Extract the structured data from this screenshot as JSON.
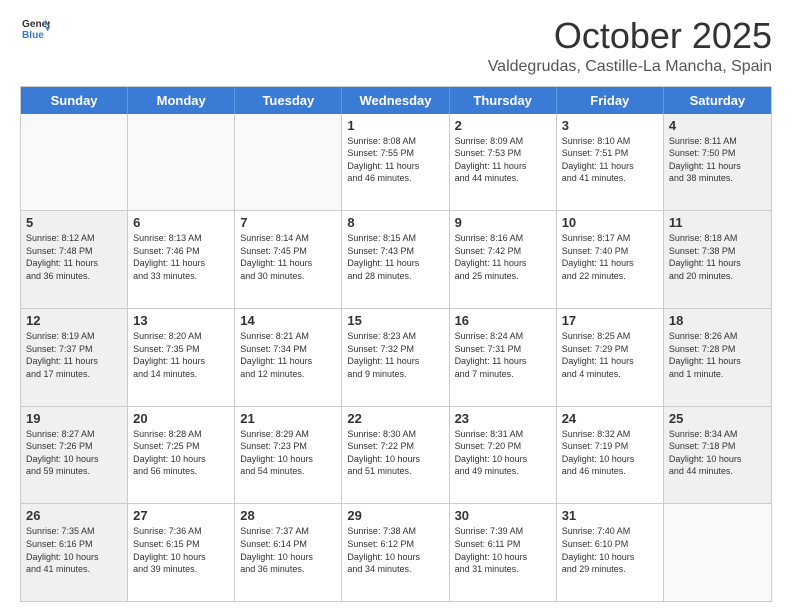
{
  "header": {
    "logo_general": "General",
    "logo_blue": "Blue",
    "month": "October 2025",
    "location": "Valdegrudas, Castille-La Mancha, Spain"
  },
  "weekdays": [
    "Sunday",
    "Monday",
    "Tuesday",
    "Wednesday",
    "Thursday",
    "Friday",
    "Saturday"
  ],
  "rows": [
    [
      {
        "day": "",
        "text": "",
        "empty": true
      },
      {
        "day": "",
        "text": "",
        "empty": true
      },
      {
        "day": "",
        "text": "",
        "empty": true
      },
      {
        "day": "1",
        "text": "Sunrise: 8:08 AM\nSunset: 7:55 PM\nDaylight: 11 hours\nand 46 minutes.",
        "empty": false
      },
      {
        "day": "2",
        "text": "Sunrise: 8:09 AM\nSunset: 7:53 PM\nDaylight: 11 hours\nand 44 minutes.",
        "empty": false
      },
      {
        "day": "3",
        "text": "Sunrise: 8:10 AM\nSunset: 7:51 PM\nDaylight: 11 hours\nand 41 minutes.",
        "empty": false
      },
      {
        "day": "4",
        "text": "Sunrise: 8:11 AM\nSunset: 7:50 PM\nDaylight: 11 hours\nand 38 minutes.",
        "empty": false,
        "shaded": true
      }
    ],
    [
      {
        "day": "5",
        "text": "Sunrise: 8:12 AM\nSunset: 7:48 PM\nDaylight: 11 hours\nand 36 minutes.",
        "empty": false,
        "shaded": true
      },
      {
        "day": "6",
        "text": "Sunrise: 8:13 AM\nSunset: 7:46 PM\nDaylight: 11 hours\nand 33 minutes.",
        "empty": false
      },
      {
        "day": "7",
        "text": "Sunrise: 8:14 AM\nSunset: 7:45 PM\nDaylight: 11 hours\nand 30 minutes.",
        "empty": false
      },
      {
        "day": "8",
        "text": "Sunrise: 8:15 AM\nSunset: 7:43 PM\nDaylight: 11 hours\nand 28 minutes.",
        "empty": false
      },
      {
        "day": "9",
        "text": "Sunrise: 8:16 AM\nSunset: 7:42 PM\nDaylight: 11 hours\nand 25 minutes.",
        "empty": false
      },
      {
        "day": "10",
        "text": "Sunrise: 8:17 AM\nSunset: 7:40 PM\nDaylight: 11 hours\nand 22 minutes.",
        "empty": false
      },
      {
        "day": "11",
        "text": "Sunrise: 8:18 AM\nSunset: 7:38 PM\nDaylight: 11 hours\nand 20 minutes.",
        "empty": false,
        "shaded": true
      }
    ],
    [
      {
        "day": "12",
        "text": "Sunrise: 8:19 AM\nSunset: 7:37 PM\nDaylight: 11 hours\nand 17 minutes.",
        "empty": false,
        "shaded": true
      },
      {
        "day": "13",
        "text": "Sunrise: 8:20 AM\nSunset: 7:35 PM\nDaylight: 11 hours\nand 14 minutes.",
        "empty": false
      },
      {
        "day": "14",
        "text": "Sunrise: 8:21 AM\nSunset: 7:34 PM\nDaylight: 11 hours\nand 12 minutes.",
        "empty": false
      },
      {
        "day": "15",
        "text": "Sunrise: 8:23 AM\nSunset: 7:32 PM\nDaylight: 11 hours\nand 9 minutes.",
        "empty": false
      },
      {
        "day": "16",
        "text": "Sunrise: 8:24 AM\nSunset: 7:31 PM\nDaylight: 11 hours\nand 7 minutes.",
        "empty": false
      },
      {
        "day": "17",
        "text": "Sunrise: 8:25 AM\nSunset: 7:29 PM\nDaylight: 11 hours\nand 4 minutes.",
        "empty": false
      },
      {
        "day": "18",
        "text": "Sunrise: 8:26 AM\nSunset: 7:28 PM\nDaylight: 11 hours\nand 1 minute.",
        "empty": false,
        "shaded": true
      }
    ],
    [
      {
        "day": "19",
        "text": "Sunrise: 8:27 AM\nSunset: 7:26 PM\nDaylight: 10 hours\nand 59 minutes.",
        "empty": false,
        "shaded": true
      },
      {
        "day": "20",
        "text": "Sunrise: 8:28 AM\nSunset: 7:25 PM\nDaylight: 10 hours\nand 56 minutes.",
        "empty": false
      },
      {
        "day": "21",
        "text": "Sunrise: 8:29 AM\nSunset: 7:23 PM\nDaylight: 10 hours\nand 54 minutes.",
        "empty": false
      },
      {
        "day": "22",
        "text": "Sunrise: 8:30 AM\nSunset: 7:22 PM\nDaylight: 10 hours\nand 51 minutes.",
        "empty": false
      },
      {
        "day": "23",
        "text": "Sunrise: 8:31 AM\nSunset: 7:20 PM\nDaylight: 10 hours\nand 49 minutes.",
        "empty": false
      },
      {
        "day": "24",
        "text": "Sunrise: 8:32 AM\nSunset: 7:19 PM\nDaylight: 10 hours\nand 46 minutes.",
        "empty": false
      },
      {
        "day": "25",
        "text": "Sunrise: 8:34 AM\nSunset: 7:18 PM\nDaylight: 10 hours\nand 44 minutes.",
        "empty": false,
        "shaded": true
      }
    ],
    [
      {
        "day": "26",
        "text": "Sunrise: 7:35 AM\nSunset: 6:16 PM\nDaylight: 10 hours\nand 41 minutes.",
        "empty": false,
        "shaded": true
      },
      {
        "day": "27",
        "text": "Sunrise: 7:36 AM\nSunset: 6:15 PM\nDaylight: 10 hours\nand 39 minutes.",
        "empty": false
      },
      {
        "day": "28",
        "text": "Sunrise: 7:37 AM\nSunset: 6:14 PM\nDaylight: 10 hours\nand 36 minutes.",
        "empty": false
      },
      {
        "day": "29",
        "text": "Sunrise: 7:38 AM\nSunset: 6:12 PM\nDaylight: 10 hours\nand 34 minutes.",
        "empty": false
      },
      {
        "day": "30",
        "text": "Sunrise: 7:39 AM\nSunset: 6:11 PM\nDaylight: 10 hours\nand 31 minutes.",
        "empty": false
      },
      {
        "day": "31",
        "text": "Sunrise: 7:40 AM\nSunset: 6:10 PM\nDaylight: 10 hours\nand 29 minutes.",
        "empty": false
      },
      {
        "day": "",
        "text": "",
        "empty": true,
        "shaded": true
      }
    ]
  ]
}
